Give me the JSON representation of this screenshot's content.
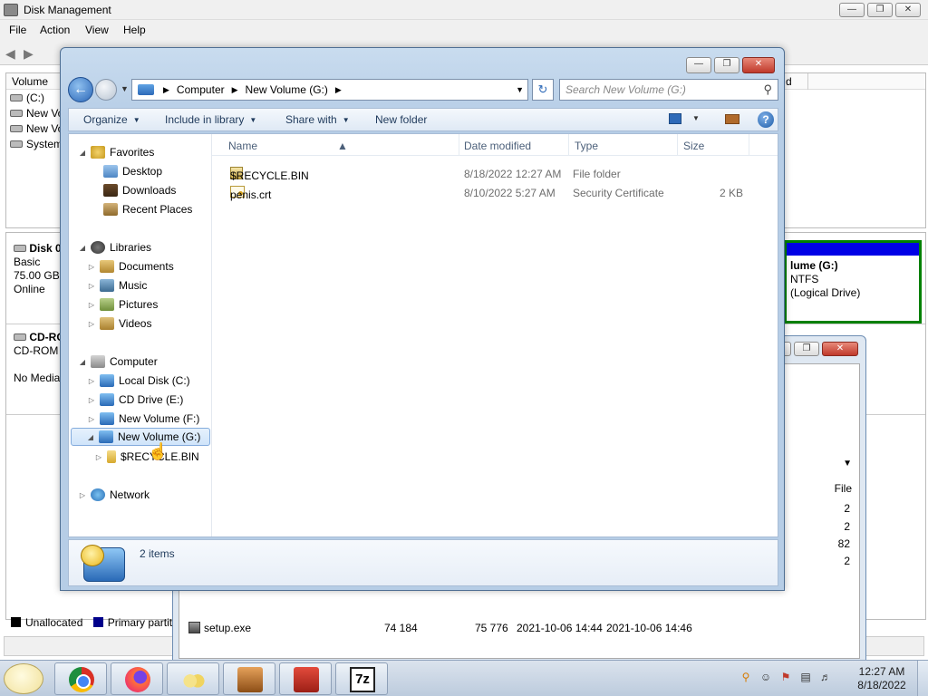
{
  "disk_mgmt": {
    "title": "Disk Management",
    "menu": [
      "File",
      "Action",
      "View",
      "Help"
    ],
    "list_header": {
      "volume": "Volume",
      "col_d": "d"
    },
    "volumes": [
      "(C:)",
      "New Vo",
      "New Vo",
      "System"
    ],
    "disks": [
      {
        "name": "Disk 0",
        "lines": [
          "Basic",
          "75.00 GB",
          "Online"
        ]
      },
      {
        "name": "CD-RO",
        "lines": [
          "CD-ROM",
          "",
          "No Media"
        ]
      }
    ],
    "partition": {
      "title": "lume  (G:)",
      "fs": "NTFS",
      "kind": "(Logical Drive)"
    },
    "legend": {
      "unallocated": "Unallocated",
      "primary": "Primary partiti"
    },
    "colors": {
      "primary": "#00008b",
      "unallocated": "#000000",
      "partition_bar": "#0000e6",
      "partition_border": "#008000"
    }
  },
  "zip_window": {
    "header_partial": "File",
    "numbers": [
      "2",
      "2",
      "82",
      "2"
    ],
    "file_row": {
      "name": "setup.exe",
      "size": "74 184",
      "packed": "75 776",
      "modified": "2021-10-06 14:44",
      "created": "2021-10-06 14:46"
    }
  },
  "explorer": {
    "breadcrumb": [
      "Computer",
      "New Volume (G:)"
    ],
    "search_placeholder": "Search New Volume (G:)",
    "commands": {
      "organize": "Organize",
      "include": "Include in library",
      "share": "Share with",
      "new_folder": "New folder"
    },
    "nav": {
      "favorites": "Favorites",
      "desktop": "Desktop",
      "downloads": "Downloads",
      "recent": "Recent Places",
      "libraries": "Libraries",
      "documents": "Documents",
      "music": "Music",
      "pictures": "Pictures",
      "videos": "Videos",
      "computer": "Computer",
      "local_c": "Local Disk (C:)",
      "cd_e": "CD Drive (E:)",
      "vol_f": "New Volume (F:)",
      "vol_g": "New Volume (G:)",
      "recycle": "$RECYCLE.BIN",
      "network": "Network"
    },
    "columns": {
      "name": "Name",
      "date": "Date modified",
      "type": "Type",
      "size": "Size"
    },
    "files": [
      {
        "name": "$RECYCLE.BIN",
        "date": "8/18/2022 12:27 AM",
        "type": "File folder",
        "size": "",
        "icon": "folder-icon"
      },
      {
        "name": "penis.crt",
        "date": "8/10/2022 5:27 AM",
        "type": "Security Certificate",
        "size": "2 KB",
        "icon": "certificate-icon"
      }
    ],
    "item_count": "2 items"
  },
  "taskbar": {
    "apps": [
      "chrome-icon",
      "firefox-icon",
      "users-icon",
      "toolbox-icon",
      "package-icon",
      "7zip-icon"
    ],
    "seven_zip_label": "7z",
    "clock_time": "12:27 AM",
    "clock_date": "8/18/2022"
  }
}
